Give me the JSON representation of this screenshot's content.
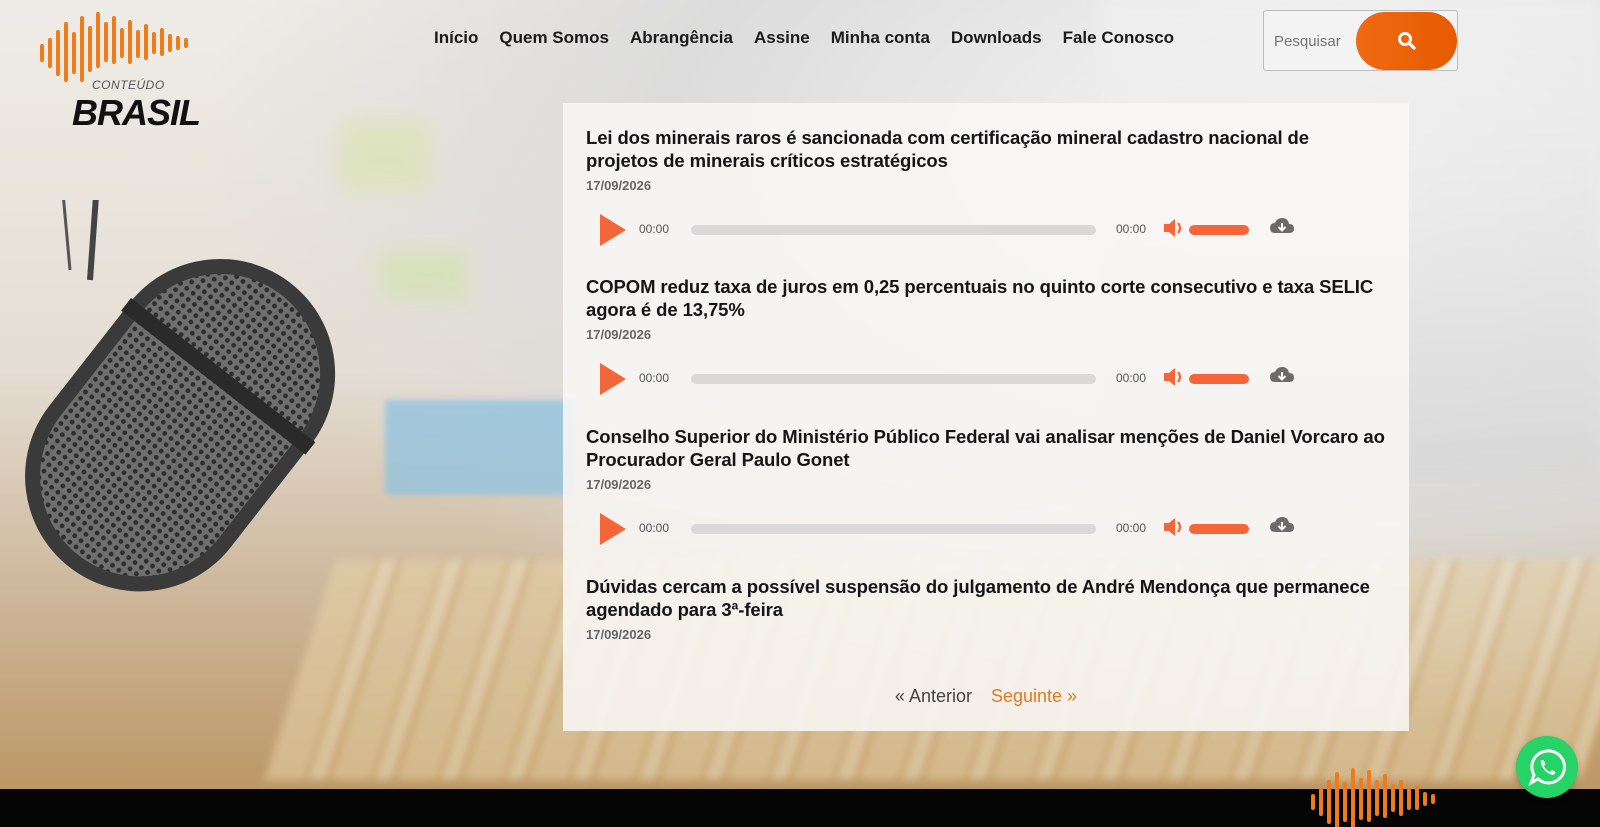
{
  "brand": {
    "small_text": "CONTEÚDO",
    "big_text": "BRASIL",
    "accent": "#f06a12"
  },
  "nav": {
    "items": [
      "Início",
      "Quem Somos",
      "Abrangência",
      "Assine",
      "Minha conta",
      "Downloads",
      "Fale Conosco"
    ]
  },
  "search": {
    "placeholder": "Pesquisar",
    "icon": "search-icon"
  },
  "posts": [
    {
      "title": "Lei dos minerais raros é sancionada com certificação mineral cadastro nacional de projetos de minerais críticos estratégicos",
      "date": "17/09/2026",
      "player": {
        "current": "00:00",
        "duration": "00:00",
        "progress": 0,
        "volume": 1
      }
    },
    {
      "title": "COPOM reduz taxa de juros em 0,25 percentuais no quinto corte consecutivo e taxa SELIC agora é de 13,75%",
      "date": "17/09/2026",
      "player": {
        "current": "00:00",
        "duration": "00:00",
        "progress": 0,
        "volume": 1
      }
    },
    {
      "title": "Conselho Superior do Ministério Público Federal vai analisar menções de Daniel Vorcaro ao Procurador Geral Paulo Gonet",
      "date": "17/09/2026",
      "player": {
        "current": "00:00",
        "duration": "00:00",
        "progress": 0,
        "volume": 1
      }
    },
    {
      "title": "Dúvidas cercam a possível suspensão do julgamento de André Mendonça que permanece agendado para 3ª-feira",
      "date": "17/09/2026"
    }
  ],
  "pagination": {
    "prev": "« Anterior",
    "next": "Seguinte »"
  },
  "colors": {
    "player_accent": "#f4663a",
    "pager_next": "#e4791d",
    "whatsapp": "#25d366",
    "footer": "#050505"
  },
  "floating": {
    "whatsapp_icon": "whatsapp-icon"
  }
}
